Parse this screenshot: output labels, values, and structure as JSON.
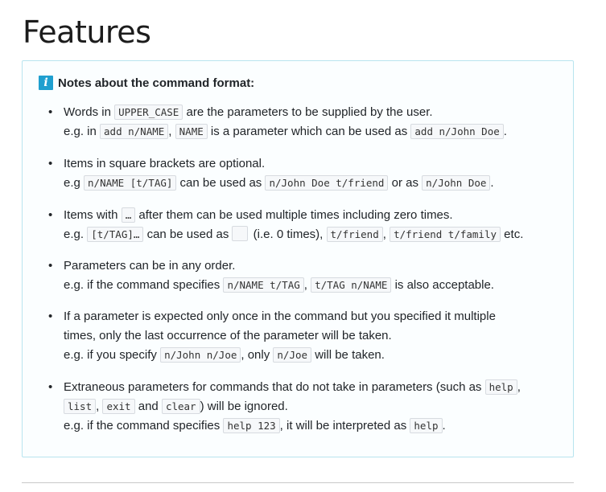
{
  "page": {
    "title": "Features"
  },
  "notes_box": {
    "icon": "info-icon",
    "icon_glyph": "i",
    "accent_color": "#1f9fcf",
    "title": "Notes about the command format:"
  },
  "items": [
    {
      "l1": [
        "Words in ",
        "UPPER_CASE",
        " are the parameters to be supplied by the user."
      ],
      "l2": [
        "e.g. in ",
        "add n/NAME",
        ", ",
        "NAME",
        " is a parameter which can be used as ",
        "add n/John Doe",
        "."
      ]
    },
    {
      "l1": [
        "Items in square brackets are optional."
      ],
      "l2": [
        "e.g ",
        "n/NAME [t/TAG]",
        " can be used as ",
        "n/John Doe t/friend",
        " or as ",
        "n/John Doe",
        "."
      ]
    },
    {
      "l1": [
        "Items with ",
        "…",
        " after them can be used multiple times including zero times."
      ],
      "l2": [
        "e.g. ",
        "[t/TAG]…",
        " can be used as ",
        "",
        " (i.e. 0 times), ",
        "t/friend",
        ", ",
        "t/friend t/family",
        " etc."
      ]
    },
    {
      "l1": [
        "Parameters can be in any order."
      ],
      "l2": [
        "e.g. if the command specifies ",
        "n/NAME t/TAG",
        ", ",
        "t/TAG n/NAME",
        " is also acceptable."
      ]
    },
    {
      "l1": [
        "If a parameter is expected only once in the command but you specified it multiple"
      ],
      "l2": [
        "times, only the last occurrence of the parameter will be taken."
      ],
      "l3": [
        "e.g. if you specify ",
        "n/John n/Joe",
        ", only ",
        "n/Joe",
        " will be taken."
      ]
    },
    {
      "l1": [
        "Extraneous parameters for commands that do not take in parameters (such as ",
        "help",
        ","
      ],
      "l2": [
        "list",
        ", ",
        "exit",
        " and ",
        "clear",
        ") will be ignored."
      ],
      "l3": [
        "e.g. if the command specifies ",
        "help 123",
        ", it will be interpreted as ",
        "help",
        "."
      ]
    }
  ]
}
